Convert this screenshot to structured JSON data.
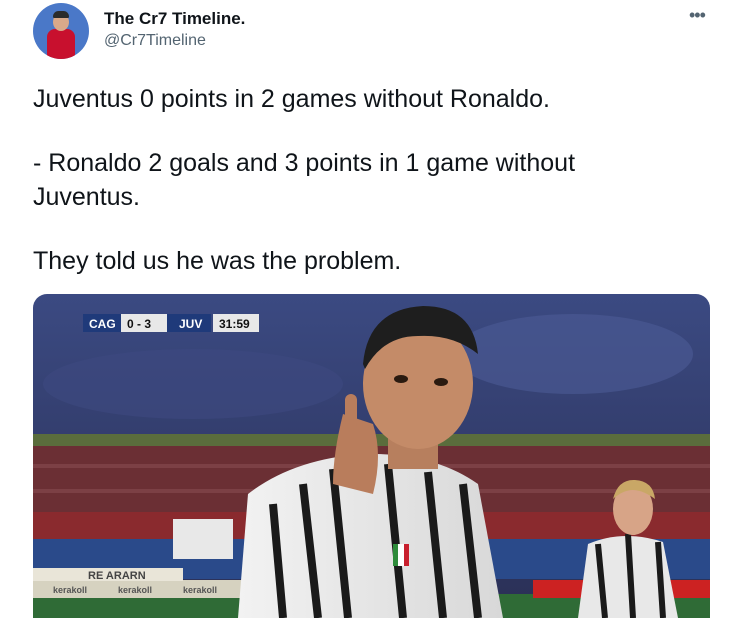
{
  "author": {
    "name": "The Cr7 Timeline.",
    "handle": "@Cr7Timeline",
    "avatar_icon": "profile-avatar"
  },
  "more_icon": "more-options-icon",
  "tweet": {
    "line1": "Juventus 0 points in 2 games without Ronaldo.",
    "line2": "- Ronaldo 2 goals and 3 points in 1 game without\nJuventus.",
    "line3": "They told us he was the problem."
  },
  "media": {
    "scoreboard": {
      "home": "CAG",
      "score": "0 - 3",
      "away": "JUV",
      "clock": "31:59"
    },
    "ad_boards": [
      "kerakoll",
      "kerakoll",
      "kerakoll"
    ],
    "board_text": "RE ARARN",
    "colors": {
      "sky": "#35406e",
      "stands": "#8a3a3a",
      "pitch": "#2f6b36"
    }
  }
}
